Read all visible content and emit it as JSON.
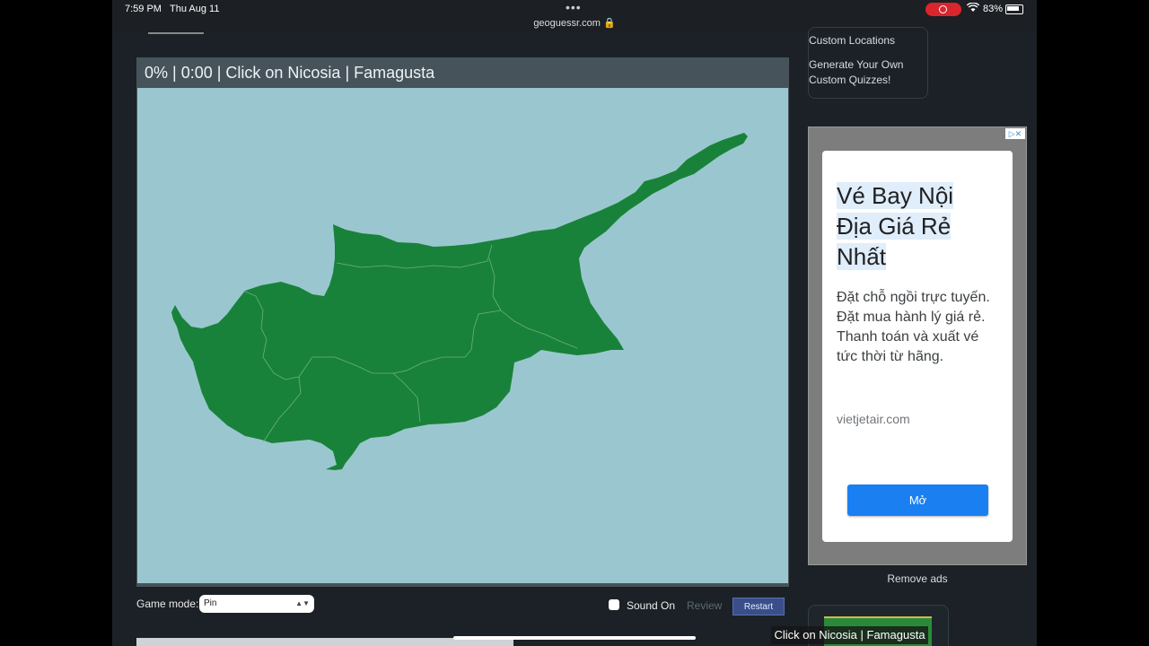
{
  "status_bar": {
    "time": "7:59 PM",
    "date": "Thu Aug 11",
    "dots": "•••",
    "url": "geoguessr.com 🔒",
    "battery": "83%"
  },
  "quiz": {
    "header": "0% | 0:00 | Click on Nicosia | Famagusta",
    "game_mode_label": "Game mode:",
    "game_mode_value": "Pin",
    "sound_label": "Sound On",
    "review_label": "Review",
    "restart_label": "Restart"
  },
  "sidebar": {
    "links": [
      "Custom Locations",
      "Generate Your Own",
      "Custom Quizzes!"
    ],
    "remove_ads": "Remove ads"
  },
  "ad": {
    "title_lines": [
      "Vé Bay Nội",
      "Địa Giá Rẻ",
      "Nhất"
    ],
    "body": "Đặt chỗ ngồi trực tuyến. Đặt mua hành lý giá rẻ. Thanh toán và xuất vé tức thời từ hãng.",
    "domain": "vietjetair.com",
    "button": "Mở",
    "close": "▷✕"
  },
  "caption": "Click on Nicosia | Famagusta",
  "colors": {
    "sea": "#9ac7cf",
    "land": "#19823a",
    "header": "#46535b",
    "ad_button": "#1a80f2"
  }
}
